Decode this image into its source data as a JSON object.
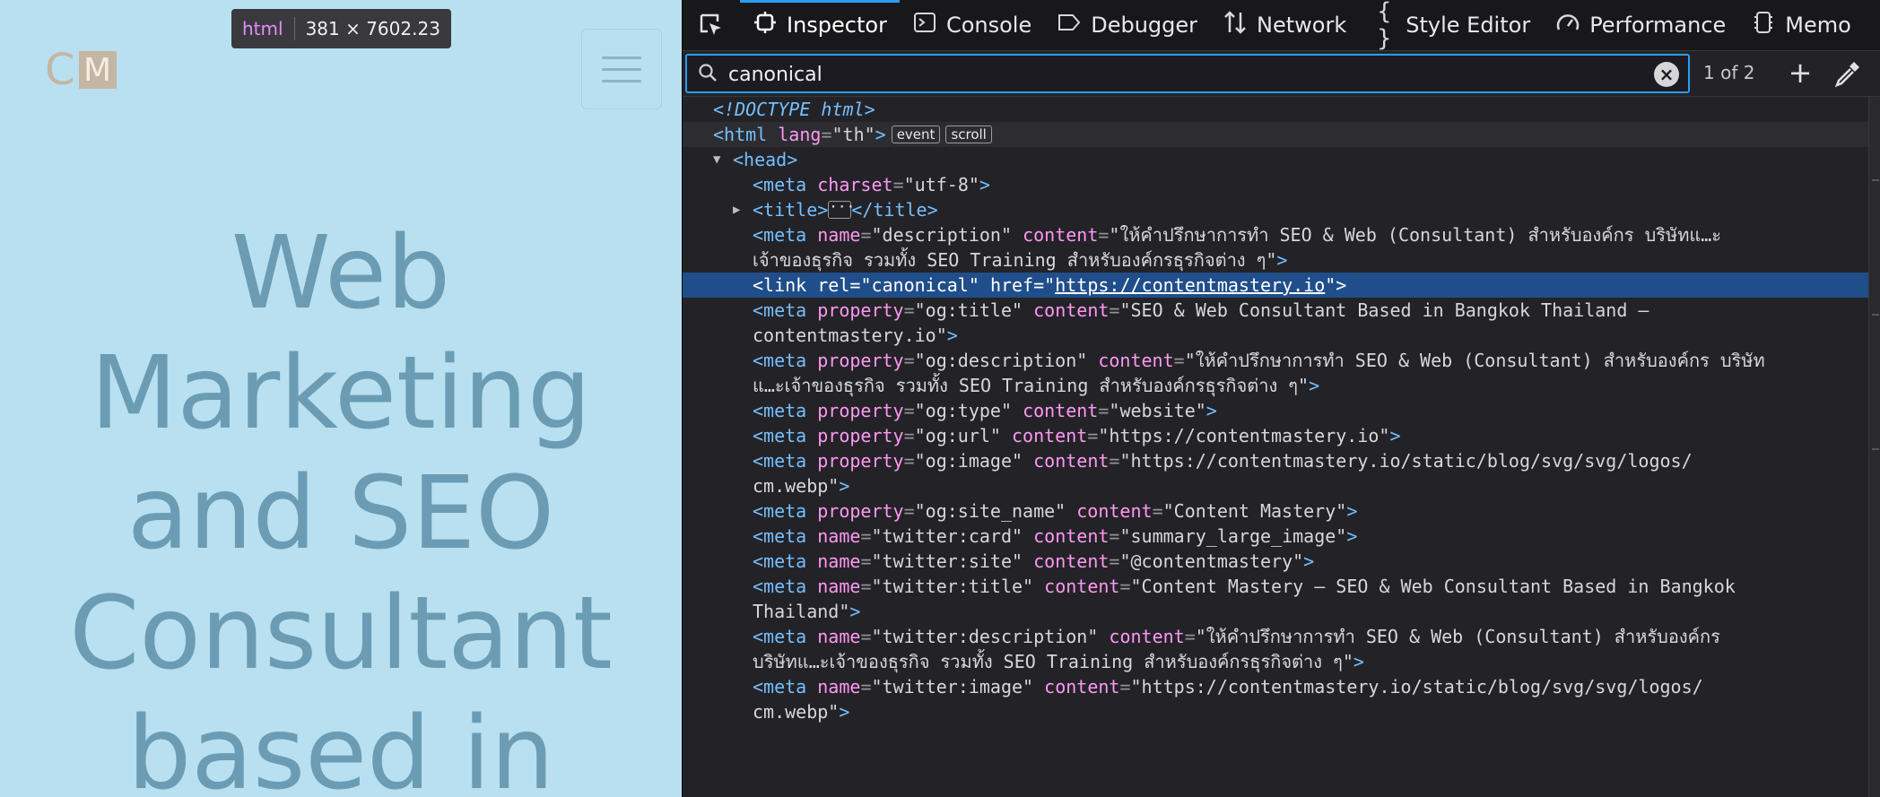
{
  "preview": {
    "logo": {
      "c": "C",
      "m": "M"
    },
    "hero_lines": [
      "Web",
      "Marketing",
      "and SEO",
      "Consultant",
      "based in"
    ],
    "tooltip": {
      "tag": "html",
      "size": "381 × 7602.23"
    }
  },
  "devtools": {
    "tabs": [
      {
        "label": "Inspector",
        "icon": "inspector-icon"
      },
      {
        "label": "Console",
        "icon": "console-icon"
      },
      {
        "label": "Debugger",
        "icon": "debugger-icon"
      },
      {
        "label": "Network",
        "icon": "network-icon"
      },
      {
        "label": "Style Editor",
        "icon": "style-editor-icon"
      },
      {
        "label": "Performance",
        "icon": "performance-icon"
      },
      {
        "label": "Memo",
        "icon": "memory-icon"
      }
    ],
    "search": {
      "value": "canonical",
      "match_count": "1 of 2"
    },
    "markup": {
      "doctype": "<!DOCTYPE html>",
      "html_open": {
        "tag": "html",
        "attr": "lang",
        "val": "\"th\"",
        "badges": [
          "event",
          "scroll"
        ]
      },
      "head": "head",
      "meta_charset": {
        "attr": "charset",
        "val": "\"utf-8\""
      },
      "title": {
        "open": "<title>",
        "close": "</title>"
      },
      "meta_desc": {
        "l1a": "name",
        "l1b": "\"description\"",
        "l1c": "content",
        "l1d": "\"ให้คำปรึกษาการทำ SEO & Web (Consultant) สำหรับองค์กร บริษัทแ…ะ",
        "l2": "เจ้าของธุรกิจ รวมทั้ง SEO Training สำหรับองค์กรธุรกิจต่าง ๆ\""
      },
      "link": {
        "rel_attr": "rel",
        "rel_val": "\"canonical\"",
        "href_attr": "href",
        "href_val": "https://contentmastery.io"
      },
      "og_title": {
        "prop": "\"og:title\"",
        "l1": "\"SEO & Web Consultant Based in Bangkok Thailand –",
        "l2": "contentmastery.io\""
      },
      "og_desc": {
        "prop": "\"og:description\"",
        "l1": "\"ให้คำปรึกษาการทำ SEO & Web (Consultant) สำหรับองค์กร บริษัท",
        "l2": "แ…ะเจ้าของธุรกิจ รวมทั้ง SEO Training สำหรับองค์กรธุรกิจต่าง ๆ\""
      },
      "og_type": {
        "prop": "\"og:type\"",
        "val": "\"website\""
      },
      "og_url": {
        "prop": "\"og:url\"",
        "val": "\"https://contentmastery.io\""
      },
      "og_image": {
        "prop": "\"og:image\"",
        "l1": "\"https://contentmastery.io/static/blog/svg/svg/logos/",
        "l2": "cm.webp\""
      },
      "og_site": {
        "prop": "\"og:site_name\"",
        "val": "\"Content Mastery\""
      },
      "tw_card": {
        "name": "\"twitter:card\"",
        "val": "\"summary_large_image\""
      },
      "tw_site": {
        "name": "\"twitter:site\"",
        "val": "\"@contentmastery\""
      },
      "tw_title": {
        "name": "\"twitter:title\"",
        "l1": "\"Content Mastery – SEO & Web Consultant Based in Bangkok",
        "l2": "Thailand\""
      },
      "tw_desc": {
        "name": "\"twitter:description\"",
        "l1": "\"ให้คำปรึกษาการทำ SEO & Web (Consultant) สำหรับองค์กร",
        "l2": "บริษัทแ…ะเจ้าของธุรกิจ รวมทั้ง SEO Training สำหรับองค์กรธุรกิจต่าง ๆ\""
      },
      "tw_image": {
        "name": "\"twitter:image\"",
        "l1": "\"https://contentmastery.io/static/blog/svg/svg/logos/",
        "l2": "cm.webp\""
      }
    }
  },
  "colors": {
    "accent": "#2a9df4",
    "preview_bg": "#b8e0f0",
    "hero_text": "#6b9cb4",
    "selection": "#204e8a"
  }
}
